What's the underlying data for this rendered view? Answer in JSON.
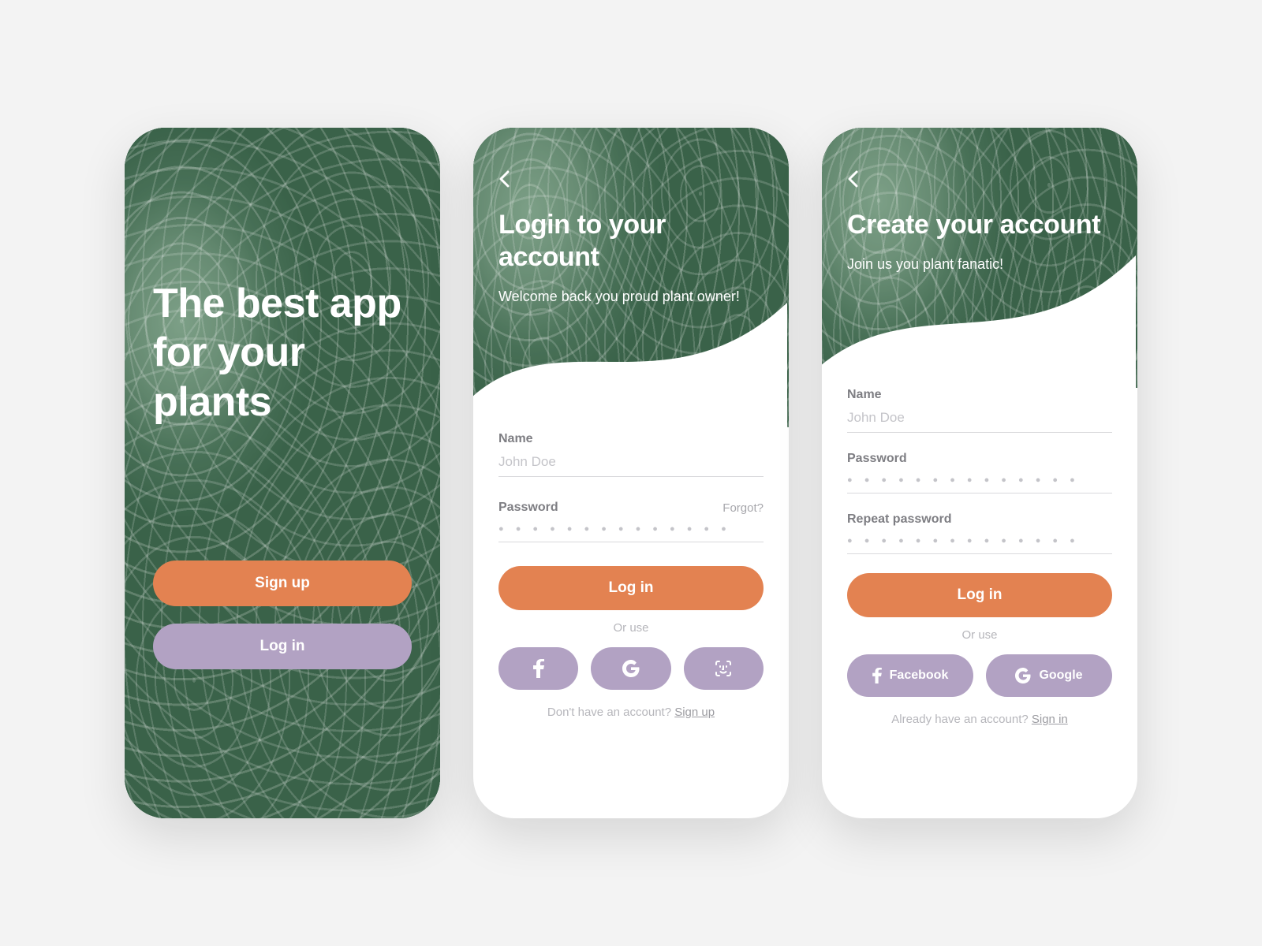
{
  "colors": {
    "accent_orange": "#e38251",
    "accent_purple": "#b2a2c3",
    "leaf_green": "#4f785e"
  },
  "landing": {
    "title": "The best app for your plants",
    "signup_label": "Sign up",
    "login_label": "Log in"
  },
  "login": {
    "title": "Login to your account",
    "subtitle": "Welcome back you proud plant owner!",
    "name_label": "Name",
    "name_placeholder": "John Doe",
    "password_label": "Password",
    "forgot_label": "Forgot?",
    "submit_label": "Log in",
    "or_use_label": "Or use",
    "social": {
      "facebook_icon": "facebook",
      "google_icon": "google",
      "faceid_icon": "face-id"
    },
    "footer_text": "Don't have an account? ",
    "footer_link": "Sign up"
  },
  "signup": {
    "title": "Create your account",
    "subtitle": "Join us you plant fanatic!",
    "name_label": "Name",
    "name_placeholder": "John Doe",
    "password_label": "Password",
    "repeat_password_label": "Repeat password",
    "submit_label": "Log in",
    "or_use_label": "Or use",
    "social_facebook_label": "Facebook",
    "social_google_label": "Google",
    "footer_text": "Already have an account? ",
    "footer_link": "Sign in"
  }
}
